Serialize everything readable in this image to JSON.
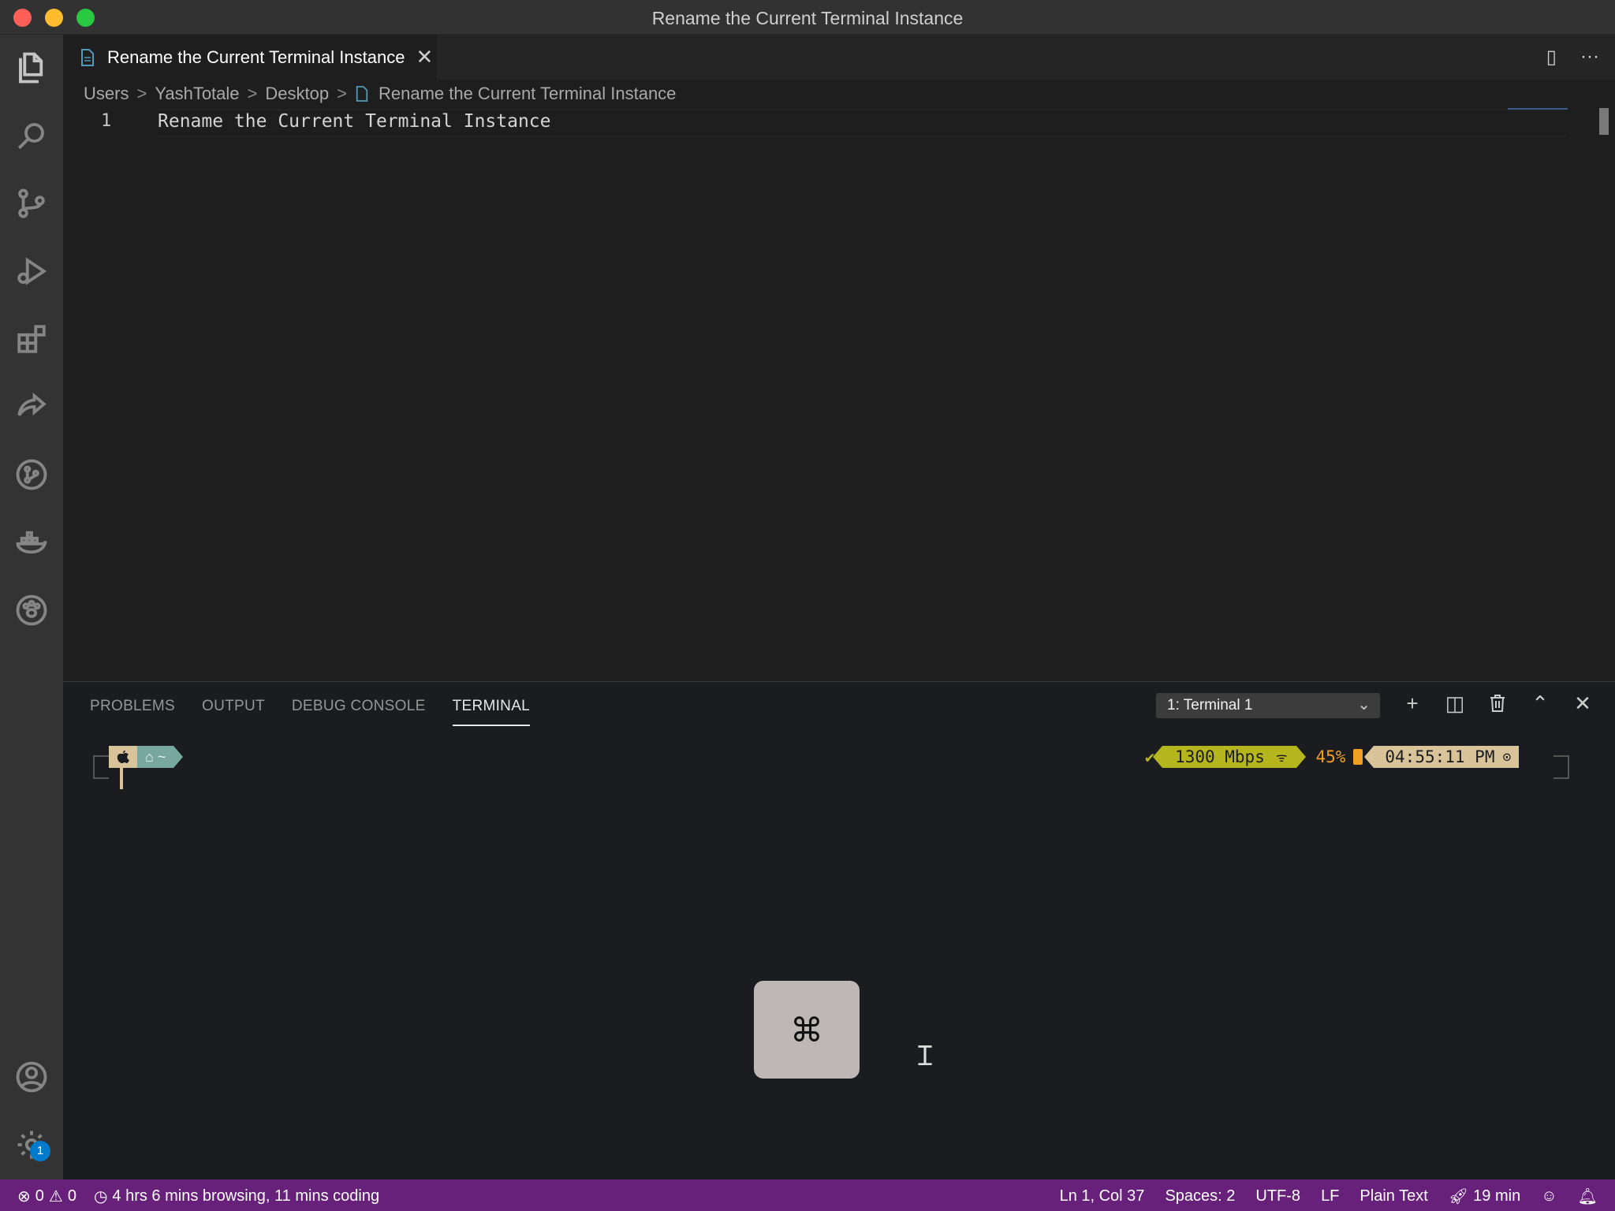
{
  "window": {
    "title": "Rename the Current Terminal Instance"
  },
  "activity_bar": {
    "items": [
      "explorer-icon",
      "search-icon",
      "source-control-icon",
      "run-debug-icon",
      "extensions-icon",
      "live-share-icon",
      "git-graph-icon",
      "docker-icon",
      "paw-icon"
    ],
    "bottom": [
      "account-icon",
      "settings-gear-icon"
    ],
    "settings_badge": "1"
  },
  "tabs": [
    {
      "label": "Rename the Current Terminal Instance",
      "close": "✕"
    }
  ],
  "tab_actions": {
    "split": "▯",
    "more": "···"
  },
  "breadcrumb": [
    "Users",
    "YashTotale",
    "Desktop",
    "Rename the Current Terminal Instance"
  ],
  "breadcrumb_sep": ">",
  "editor": {
    "lines": [
      {
        "number": "1",
        "text": "Rename the Current Terminal Instance"
      }
    ]
  },
  "panel": {
    "tabs": [
      "PROBLEMS",
      "OUTPUT",
      "DEBUG CONSOLE",
      "TERMINAL"
    ],
    "active_tab": "TERMINAL",
    "terminal_select": "1: Terminal 1",
    "chevron": "⌄",
    "actions": {
      "add": "+",
      "split": "◫",
      "trash": "🗑",
      "maximize": "⌃",
      "close": "✕"
    }
  },
  "terminal": {
    "prompt_left": {
      "apple": "",
      "home": "⌂ ~"
    },
    "prompt_right": {
      "check": "✔",
      "network": "1300 Mbps",
      "wifi": "ᯤ",
      "battery": "45%",
      "time": "04:55:11 PM",
      "clock": "⊙"
    }
  },
  "keycast": {
    "key": "⌘"
  },
  "statusbar": {
    "errors": "0",
    "warnings": "0",
    "activity": "4 hrs 6 mins browsing, 11 mins coding",
    "position": "Ln 1, Col 37",
    "spaces": "Spaces: 2",
    "encoding": "UTF-8",
    "eol": "LF",
    "language": "Plain Text",
    "session": "19 min"
  },
  "colors": {
    "statusbar": "#68217a",
    "accent": "#007acc"
  }
}
